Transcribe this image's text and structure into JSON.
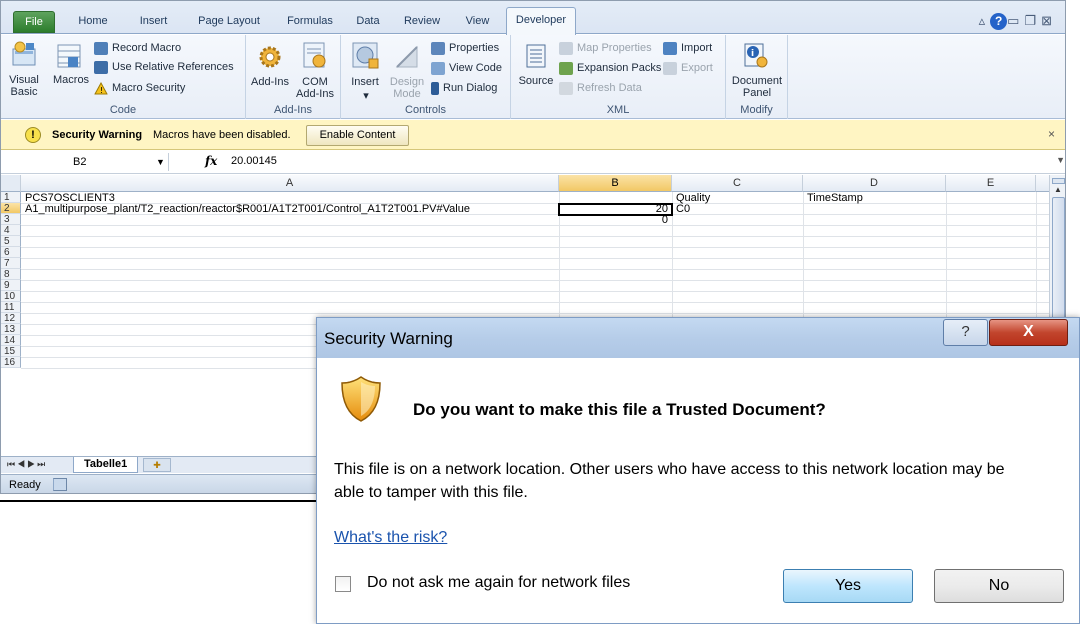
{
  "ribbon_tabs": [
    "File",
    "Home",
    "Insert",
    "Page Layout",
    "Formulas",
    "Data",
    "Review",
    "View",
    "Developer"
  ],
  "active_tab": "Developer",
  "groups": {
    "code": {
      "label": "Code",
      "visual_basic": "Visual\nBasic",
      "macros": "Macros",
      "record_macro": "Record Macro",
      "use_relative": "Use Relative References",
      "macro_security": "Macro Security"
    },
    "addins": {
      "label": "Add-Ins",
      "addins_btn": "Add-Ins",
      "com_addins": "COM\nAdd-Ins"
    },
    "controls": {
      "label": "Controls",
      "insert": "Insert",
      "design_mode": "Design\nMode",
      "properties": "Properties",
      "view_code": "View Code",
      "run_dialog": "Run Dialog"
    },
    "xml": {
      "label": "XML",
      "source": "Source",
      "map_properties": "Map Properties",
      "expansion_packs": "Expansion Packs",
      "refresh_data": "Refresh Data",
      "import": "Import",
      "export": "Export"
    },
    "modify": {
      "label": "Modify",
      "document_panel": "Document\nPanel"
    }
  },
  "message_bar": {
    "title": "Security Warning",
    "text": "Macros have been disabled.",
    "button": "Enable Content",
    "close": "×"
  },
  "formula_bar": {
    "name_box": "B2",
    "fx": "fx",
    "value": "20.00145"
  },
  "columns": [
    "A",
    "B",
    "C",
    "D",
    "E"
  ],
  "rows": [
    "1",
    "2",
    "3",
    "4",
    "5",
    "6",
    "7",
    "8",
    "9",
    "10",
    "11",
    "12",
    "13",
    "14",
    "15",
    "16"
  ],
  "cells": {
    "A1": "PCS7OSCLIENT3",
    "C1": "Quality",
    "D1": "TimeStamp",
    "A2": "A1_multipurpose_plant/T2_reaction/reactor$R001/A1T2T001/Control_A1T2T001.PV#Value",
    "B2": "20",
    "C2": "C0",
    "B3": "0"
  },
  "sheet_tab": "Tabelle1",
  "status": "Ready",
  "dialog": {
    "title": "Security Warning",
    "help": "?",
    "close": "X",
    "heading": "Do you want to make this file a Trusted Document?",
    "body": "This file is on a network location. Other users who have access to this network location may be able to tamper with this file.",
    "risk_link": "What's the risk?",
    "checkbox_label": "Do not ask me again for network files",
    "yes": "Yes",
    "no": "No"
  }
}
